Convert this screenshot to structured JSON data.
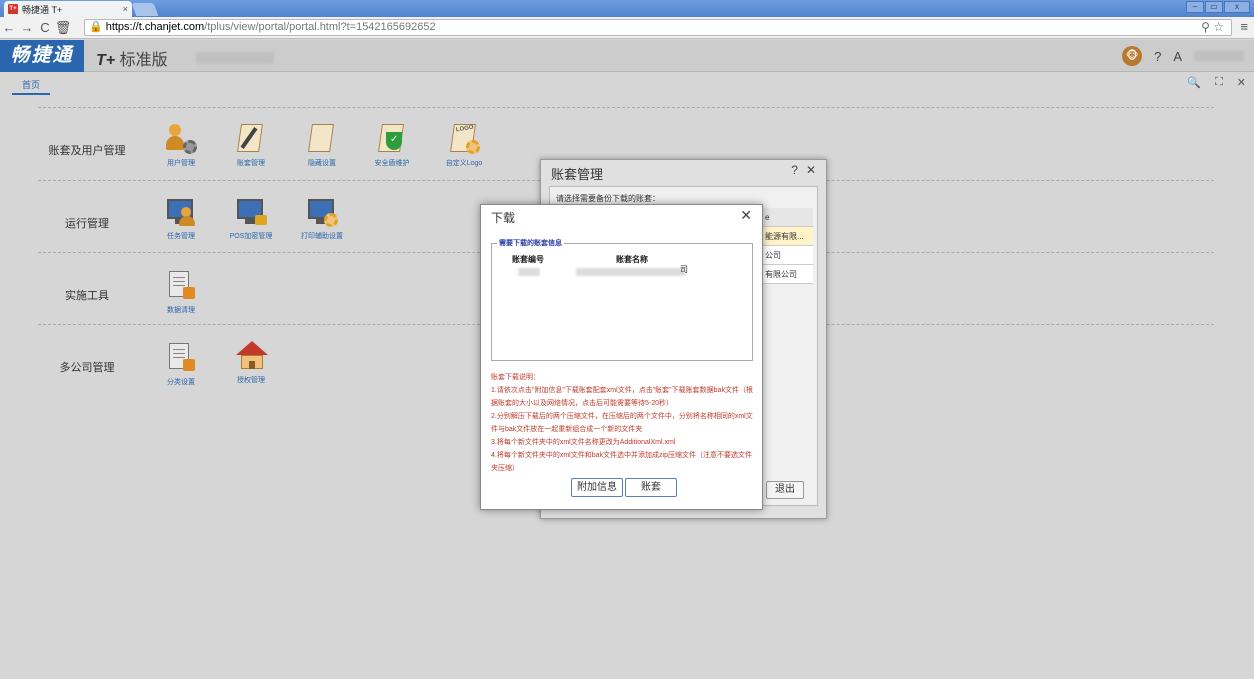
{
  "browser": {
    "tab_title": "畅捷通 T+",
    "tab_close": "×",
    "favicon_text": "T+",
    "url_scheme_host": "https://t.chanjet.com",
    "url_path": "/tplus/view/portal/portal.html?t=1542165692652",
    "back": "←",
    "forward": "→",
    "reload": "C",
    "home": "🗑",
    "lock": "🔒",
    "right_icons": "⚲ ☆",
    "menu": "≡",
    "win_min": "–",
    "win_max": "▭",
    "win_close": "x"
  },
  "header": {
    "brand": "畅捷通",
    "product_prefix": "T+",
    "product_name": "标准版",
    "help_icon": "?",
    "user_icon": "A"
  },
  "page_tabs": {
    "home": "首页",
    "search": "🔍",
    "fullscreen": "⛶",
    "close": "✕"
  },
  "modules": [
    {
      "title": "账套及用户管理",
      "items": [
        {
          "label": "用户管理",
          "icon": "user-gear-icon"
        },
        {
          "label": "账套管理",
          "icon": "book-pen-icon"
        },
        {
          "label": "隐藏设置",
          "icon": "book-icon"
        },
        {
          "label": "安全盾维护",
          "icon": "shield-icon"
        },
        {
          "label": "自定义Logo",
          "icon": "logo-gear-icon"
        }
      ]
    },
    {
      "title": "运行管理",
      "items": [
        {
          "label": "任务管理",
          "icon": "monitor-user-icon"
        },
        {
          "label": "POS加密管理",
          "icon": "monitor-lock-icon"
        },
        {
          "label": "打印辅助设置",
          "icon": "monitor-gear-icon"
        }
      ]
    },
    {
      "title": "实施工具",
      "items": [
        {
          "label": "数据清理",
          "icon": "document-icon"
        }
      ]
    },
    {
      "title": "多公司管理",
      "items": [
        {
          "label": "分类设置",
          "icon": "document-icon"
        },
        {
          "label": "授权管理",
          "icon": "house-icon"
        }
      ]
    }
  ],
  "account_dialog": {
    "title": "账套管理",
    "help": "?",
    "close": "✕",
    "prompt": "请选择需要备份下载的账套：",
    "rows": [
      {
        "text": "e"
      },
      {
        "text": "能源有限..."
      },
      {
        "text": "公司"
      },
      {
        "text": "有限公司"
      }
    ],
    "exit": "退出"
  },
  "download_dialog": {
    "title": "下载",
    "close": "✕",
    "legend": "需要下载的账套信息",
    "col_number": "账套编号",
    "col_name": "账套名称",
    "name_suffix": "司",
    "info_title": "账套下载说明：",
    "info_lines": [
      "1.请依次点击\"附加信息\"下载账套配套xml文件，点击\"账套\"下载账套数据bak文件（根据账套的大小以及网络情况，点击后可能需要等待5-20秒）",
      "2.分别解压下载后的两个压缩文件，在压缩后的两个文件中，分别将名称相同的xml文件与bak文件放在一起重新组合成一个新的文件夹",
      "3.将每个新文件夹中的xml文件名称更改为AdditionalXml.xml",
      "4.将每个新文件夹中的xml文件和bak文件选中并添加成zip压缩文件（注意不要选文件夹压缩）"
    ],
    "btn_extra": "附加信息",
    "btn_account": "账套"
  }
}
